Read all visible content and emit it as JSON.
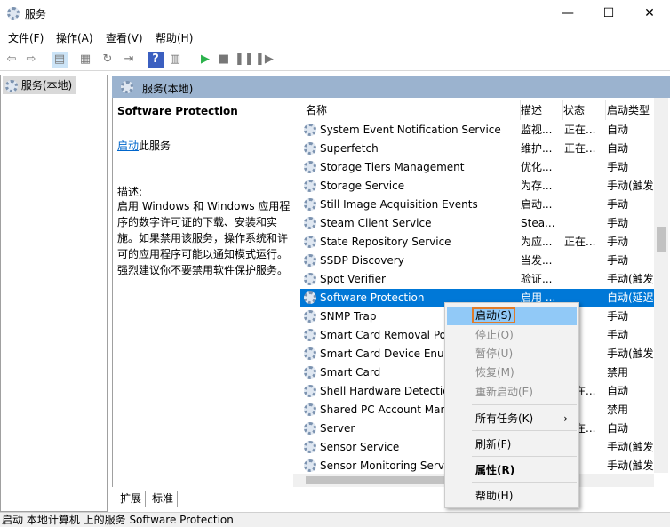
{
  "window": {
    "title": "服务",
    "minimize": "—",
    "maximize": "☐",
    "close": "✕"
  },
  "menu": [
    "文件(F)",
    "操作(A)",
    "查看(V)",
    "帮助(H)"
  ],
  "toolbar": [
    {
      "icon": "back-arrow-icon",
      "glyph": "⇦"
    },
    {
      "icon": "forward-arrow-icon",
      "glyph": "⇨"
    },
    {
      "icon": "show-tree-icon",
      "glyph": "▤"
    },
    {
      "icon": "properties-icon",
      "glyph": "▦"
    },
    {
      "icon": "refresh-icon",
      "glyph": "↻"
    },
    {
      "icon": "export-icon",
      "glyph": "⇥"
    },
    {
      "icon": "help-icon",
      "glyph": "?"
    },
    {
      "icon": "action-pane-icon",
      "glyph": "▥"
    },
    {
      "icon": "start-icon",
      "glyph": "▶"
    },
    {
      "icon": "stop-icon",
      "glyph": "■"
    },
    {
      "icon": "pause-icon",
      "glyph": "❚❚"
    },
    {
      "icon": "resume-icon",
      "glyph": "❚▶"
    }
  ],
  "tree": {
    "item": "服务(本地)"
  },
  "right_header": "服务(本地)",
  "detail": {
    "name": "Software Protection",
    "start_link": "启动",
    "start_suffix": "此服务",
    "desc_label": "描述:",
    "desc": "启用 Windows 和 Windows 应用程序的数字许可证的下载、安装和实施。如果禁用该服务，操作系统和许可的应用程序可能以通知模式运行。强烈建议你不要禁用软件保护服务。"
  },
  "columns": [
    "名称",
    "描述",
    "状态",
    "启动类型"
  ],
  "services": [
    {
      "name": "System Event Notification Service",
      "desc": "监视...",
      "status": "正在...",
      "startup": "自动"
    },
    {
      "name": "Superfetch",
      "desc": "维护...",
      "status": "正在...",
      "startup": "自动"
    },
    {
      "name": "Storage Tiers Management",
      "desc": "优化...",
      "status": "",
      "startup": "手动"
    },
    {
      "name": "Storage Service",
      "desc": "为存...",
      "status": "",
      "startup": "手动(触发"
    },
    {
      "name": "Still Image Acquisition Events",
      "desc": "启动...",
      "status": "",
      "startup": "手动"
    },
    {
      "name": "Steam Client Service",
      "desc": "Stea...",
      "status": "",
      "startup": "手动"
    },
    {
      "name": "State Repository Service",
      "desc": "为应...",
      "status": "正在...",
      "startup": "手动"
    },
    {
      "name": "SSDP Discovery",
      "desc": "当发...",
      "status": "",
      "startup": "手动"
    },
    {
      "name": "Spot Verifier",
      "desc": "验证...",
      "status": "",
      "startup": "手动(触发"
    },
    {
      "name": "Software Protection",
      "desc": "启用 ...",
      "status": "",
      "startup": "自动(延迟"
    },
    {
      "name": "SNMP Trap",
      "desc": "",
      "status": "",
      "startup": "手动"
    },
    {
      "name": "Smart Card Removal Po",
      "desc": "",
      "status": "",
      "startup": "手动"
    },
    {
      "name": "Smart Card Device Enun",
      "desc": "",
      "status": "",
      "startup": "手动(触发"
    },
    {
      "name": "Smart Card",
      "desc": "",
      "status": "",
      "startup": "禁用"
    },
    {
      "name": "Shell Hardware Detectio",
      "desc": "",
      "status": "正在...",
      "startup": "自动"
    },
    {
      "name": "Shared PC Account Man",
      "desc": "",
      "status": "",
      "startup": "禁用"
    },
    {
      "name": "Server",
      "desc": "",
      "status": "正在...",
      "startup": "自动"
    },
    {
      "name": "Sensor Service",
      "desc": "",
      "status": "",
      "startup": "手动(触发"
    },
    {
      "name": "Sensor Monitoring Serv",
      "desc": "",
      "status": "",
      "startup": "手动(触发"
    }
  ],
  "selected_index": 9,
  "tabs": [
    "扩展",
    "标准"
  ],
  "status_bar": "启动 本地计算机 上的服务 Software Protection",
  "context_menu": [
    {
      "label": "启动(S)",
      "enabled": true,
      "highlighted": true
    },
    {
      "label": "停止(O)",
      "enabled": false
    },
    {
      "label": "暂停(U)",
      "enabled": false
    },
    {
      "label": "恢复(M)",
      "enabled": false
    },
    {
      "label": "重新启动(E)",
      "enabled": false
    },
    {
      "label": "所有任务(K)",
      "enabled": true,
      "submenu": "›"
    },
    {
      "label": "刷新(F)",
      "enabled": true
    },
    {
      "label": "属性(R)",
      "enabled": true,
      "bold": true
    },
    {
      "label": "帮助(H)",
      "enabled": true
    }
  ],
  "colors": {
    "selection": "#0078d7",
    "header": "#9bb3cf",
    "menu_highlight": "#91c9f7",
    "highlight_border": "#e07b28",
    "link": "#0066cc"
  }
}
